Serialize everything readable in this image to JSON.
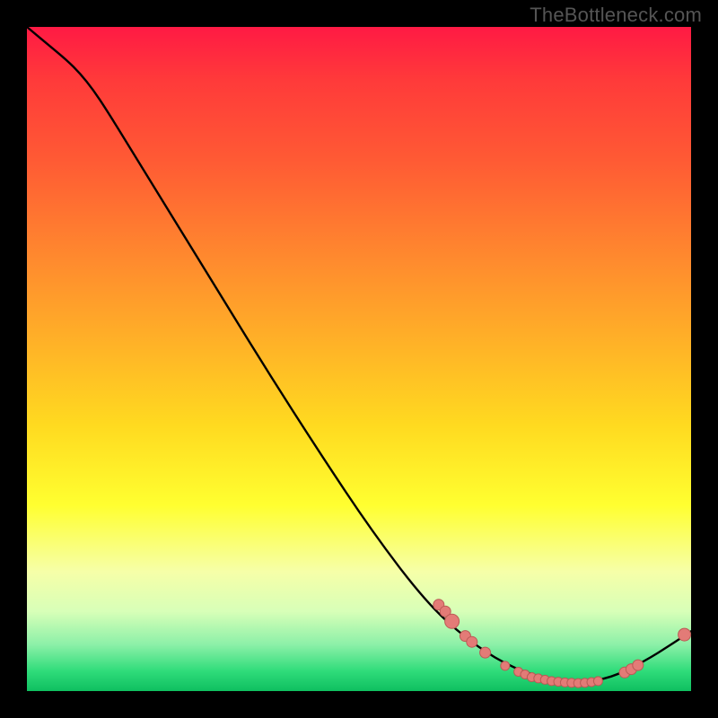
{
  "watermark": "TheBottleneck.com",
  "colors": {
    "curve": "#000000",
    "marker_fill": "#e37b77",
    "marker_stroke": "#bb5a55",
    "bg_black": "#000000"
  },
  "chart_data": {
    "type": "line",
    "title": "",
    "xlabel": "",
    "ylabel": "",
    "xlim": [
      0,
      100
    ],
    "ylim": [
      0,
      100
    ],
    "grid": false,
    "curve": [
      {
        "x": 0,
        "y": 100
      },
      {
        "x": 3,
        "y": 97.5
      },
      {
        "x": 6,
        "y": 95
      },
      {
        "x": 8,
        "y": 93
      },
      {
        "x": 10,
        "y": 90.5
      },
      {
        "x": 12,
        "y": 87.5
      },
      {
        "x": 16,
        "y": 81
      },
      {
        "x": 20,
        "y": 74.5
      },
      {
        "x": 28,
        "y": 61.5
      },
      {
        "x": 36,
        "y": 48.5
      },
      {
        "x": 44,
        "y": 36
      },
      {
        "x": 52,
        "y": 24
      },
      {
        "x": 60,
        "y": 13.5
      },
      {
        "x": 66,
        "y": 8
      },
      {
        "x": 72,
        "y": 4
      },
      {
        "x": 78,
        "y": 1.8
      },
      {
        "x": 83,
        "y": 1.2
      },
      {
        "x": 88,
        "y": 2
      },
      {
        "x": 93,
        "y": 4.5
      },
      {
        "x": 97,
        "y": 7
      },
      {
        "x": 100,
        "y": 9
      }
    ],
    "markers": [
      {
        "x": 62,
        "y": 13,
        "r": 6
      },
      {
        "x": 63,
        "y": 12,
        "r": 6
      },
      {
        "x": 64,
        "y": 10.5,
        "r": 8
      },
      {
        "x": 66,
        "y": 8.3,
        "r": 6
      },
      {
        "x": 67,
        "y": 7.4,
        "r": 6
      },
      {
        "x": 69,
        "y": 5.8,
        "r": 6
      },
      {
        "x": 72,
        "y": 3.8,
        "r": 5
      },
      {
        "x": 74,
        "y": 2.9,
        "r": 5
      },
      {
        "x": 75,
        "y": 2.5,
        "r": 5
      },
      {
        "x": 76,
        "y": 2.1,
        "r": 5
      },
      {
        "x": 77,
        "y": 1.9,
        "r": 5
      },
      {
        "x": 78,
        "y": 1.7,
        "r": 5
      },
      {
        "x": 79,
        "y": 1.5,
        "r": 5
      },
      {
        "x": 80,
        "y": 1.4,
        "r": 5
      },
      {
        "x": 81,
        "y": 1.3,
        "r": 5
      },
      {
        "x": 82,
        "y": 1.25,
        "r": 5
      },
      {
        "x": 83,
        "y": 1.2,
        "r": 5
      },
      {
        "x": 84,
        "y": 1.25,
        "r": 5
      },
      {
        "x": 85,
        "y": 1.35,
        "r": 5
      },
      {
        "x": 86,
        "y": 1.5,
        "r": 5
      },
      {
        "x": 90,
        "y": 2.8,
        "r": 6
      },
      {
        "x": 91,
        "y": 3.3,
        "r": 6
      },
      {
        "x": 92,
        "y": 3.9,
        "r": 6
      },
      {
        "x": 99,
        "y": 8.5,
        "r": 7
      }
    ]
  }
}
